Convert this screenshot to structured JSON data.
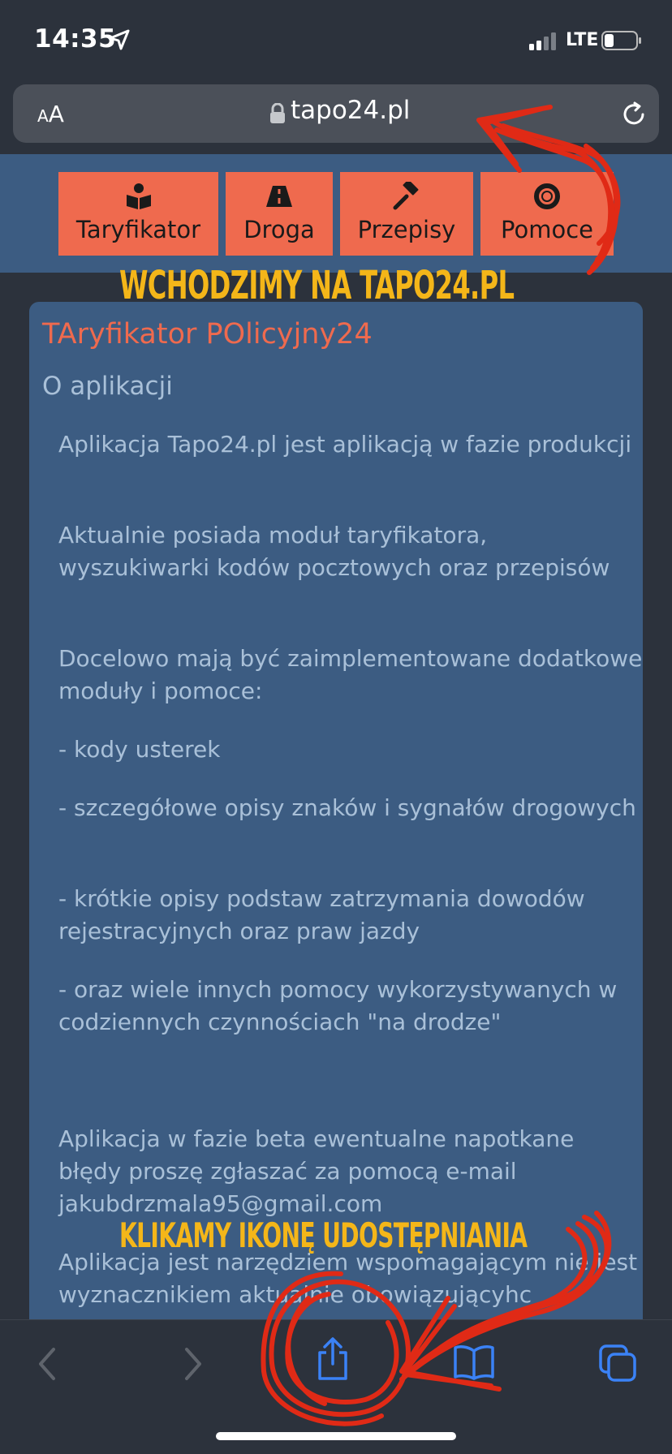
{
  "status_bar": {
    "time": "14:35",
    "network": "LTE"
  },
  "browser": {
    "text_size_label_small": "A",
    "text_size_label_large": "A",
    "url": "tapo24.pl"
  },
  "site_nav": {
    "items": [
      {
        "label": "Taryfikator",
        "icon": "book-reader-icon"
      },
      {
        "label": "Droga",
        "icon": "road-icon"
      },
      {
        "label": "Przepisy",
        "icon": "gavel-icon"
      },
      {
        "label": "Pomoce",
        "icon": "life-ring-icon"
      }
    ]
  },
  "annotations": {
    "top": "WCHODZIMY NA TAPO24.PL",
    "bottom": "KLIKAMY IKONĘ UDOSTĘPNIANIA"
  },
  "card": {
    "title": "TAryfikator POlicyjny24",
    "subtitle": "O aplikacji",
    "paragraphs": [
      "Aplikacja Tapo24.pl jest aplikacją w fazie produkcji",
      "Aktualnie posiada moduł taryfikatora, wyszukiwarki kodów pocztowych oraz przepisów",
      "Docelowo mają być zaimplementowane dodatkowe moduły i pomoce:",
      "- kody usterek",
      "- szczegółowe opisy znaków i sygnałów drogowych",
      "- krótkie opisy podstaw zatrzymania dowodów rejestracyjnych oraz praw jazdy",
      "- oraz wiele innych pomocy wykorzystywanych w codziennych czynnościach \"na drodze\"",
      "Aplikacja w fazie beta ewentualne napotkane błędy proszę zgłaszać za pomocą e-mail jakubdrzmala95@gmail.com",
      "Aplikacja jest narzędziem wspomagającym nie jest wyznacznikiem aktualnie obowiązującyhc"
    ]
  },
  "toolbar": {
    "items": [
      "back-icon",
      "forward-icon",
      "share-icon",
      "bookmarks-icon",
      "tabs-icon"
    ]
  },
  "colors": {
    "background": "#2c323c",
    "site_blue": "#3c5c82",
    "accent_orange": "#ef6a4e",
    "annotation_yellow": "#f4b619",
    "annotation_red": "#e02a16",
    "link_blue": "#3b82f6"
  }
}
